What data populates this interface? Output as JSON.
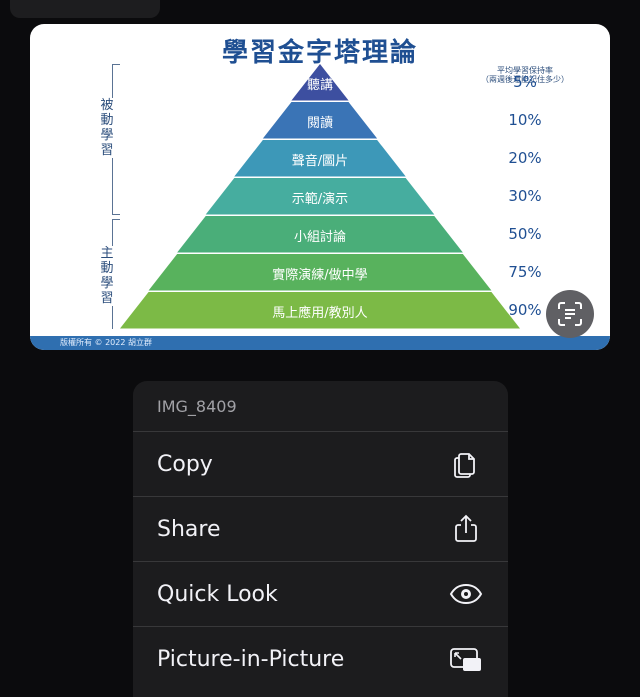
{
  "slide": {
    "title": "學習金字塔理論",
    "passive_label": "被動學習",
    "active_label": "主動學習",
    "rate_header_line1": "平均學習保持率",
    "rate_header_line2": "（兩週後還能記住多少）",
    "levels": [
      {
        "label": "聽講",
        "rate": "5%",
        "color": "#3d4fa0"
      },
      {
        "label": "閱讀",
        "rate": "10%",
        "color": "#3a74b6"
      },
      {
        "label": "聲音/圖片",
        "rate": "20%",
        "color": "#3d98b8"
      },
      {
        "label": "示範/演示",
        "rate": "30%",
        "color": "#46ad9f"
      },
      {
        "label": "小組討論",
        "rate": "50%",
        "color": "#4aae79"
      },
      {
        "label": "實際演練/做中學",
        "rate": "75%",
        "color": "#58b25d"
      },
      {
        "label": "馬上應用/教別人",
        "rate": "90%",
        "color": "#7cba46"
      }
    ],
    "footer": "版權所有 © 2022 胡立群"
  },
  "lens_button": {
    "icon": "text-scan-icon"
  },
  "menu": {
    "title": "IMG_8409",
    "items": [
      {
        "label": "Copy",
        "icon": "copy-icon"
      },
      {
        "label": "Share",
        "icon": "share-icon"
      },
      {
        "label": "Quick Look",
        "icon": "eye-icon"
      },
      {
        "label": "Picture-in-Picture",
        "icon": "pip-icon"
      }
    ]
  }
}
